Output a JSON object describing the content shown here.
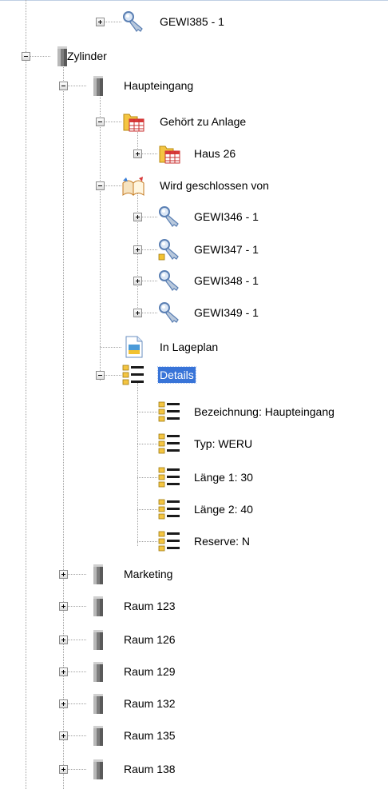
{
  "tree": [
    {
      "label": "GEWI385 - 1",
      "level": 2,
      "icon": "key-icon",
      "expander": "plus"
    },
    {
      "label": "Zylinder",
      "level": 0,
      "icon": "cylinder-icon",
      "expander": "minus"
    },
    {
      "label": "Haupteingang",
      "level": 1,
      "icon": "cylinder-icon",
      "expander": "minus"
    },
    {
      "label": "Gehört zu Anlage",
      "level": 2,
      "icon": "folder-grid-icon",
      "expander": "minus"
    },
    {
      "label": "Haus 26",
      "level": 3,
      "icon": "folder-grid-icon",
      "expander": "plus"
    },
    {
      "label": "Wird geschlossen von",
      "level": 2,
      "icon": "open-book-icon",
      "expander": "minus"
    },
    {
      "label": "GEWI346 - 1",
      "level": 3,
      "icon": "key-icon",
      "expander": "plus"
    },
    {
      "label": "GEWI347 - 1",
      "level": 3,
      "icon": "key-warning-icon",
      "expander": "plus"
    },
    {
      "label": "GEWI348 - 1",
      "level": 3,
      "icon": "key-icon",
      "expander": "plus"
    },
    {
      "label": "GEWI349 - 1",
      "level": 3,
      "icon": "key-icon",
      "expander": "plus"
    },
    {
      "label": "In Lageplan",
      "level": 2,
      "icon": "document-image-icon",
      "expander": "none"
    },
    {
      "label": "Details",
      "level": 2,
      "icon": "details-list-icon",
      "expander": "minus",
      "selected": true
    },
    {
      "label": "Bezeichnung: Haupteingang",
      "level": 3,
      "icon": "details-list-icon",
      "expander": "none"
    },
    {
      "label": "Typ: WERU",
      "level": 3,
      "icon": "details-list-icon",
      "expander": "none"
    },
    {
      "label": "Länge 1: 30",
      "level": 3,
      "icon": "details-list-icon",
      "expander": "none"
    },
    {
      "label": "Länge 2: 40",
      "level": 3,
      "icon": "details-list-icon",
      "expander": "none"
    },
    {
      "label": "Reserve: N",
      "level": 3,
      "icon": "details-list-icon",
      "expander": "none"
    },
    {
      "label": "Marketing",
      "level": 1,
      "icon": "cylinder-icon",
      "expander": "plus"
    },
    {
      "label": "Raum 123",
      "level": 1,
      "icon": "cylinder-icon",
      "expander": "plus"
    },
    {
      "label": "Raum 126",
      "level": 1,
      "icon": "cylinder-icon",
      "expander": "plus"
    },
    {
      "label": "Raum 129",
      "level": 1,
      "icon": "cylinder-icon",
      "expander": "plus"
    },
    {
      "label": "Raum 132",
      "level": 1,
      "icon": "cylinder-icon",
      "expander": "plus"
    },
    {
      "label": "Raum 135",
      "level": 1,
      "icon": "cylinder-icon",
      "expander": "plus"
    },
    {
      "label": "Raum 138",
      "level": 1,
      "icon": "cylinder-icon",
      "expander": "plus"
    }
  ],
  "colors": {
    "selection": "#3874d8",
    "connector": "#a0a0a0"
  }
}
